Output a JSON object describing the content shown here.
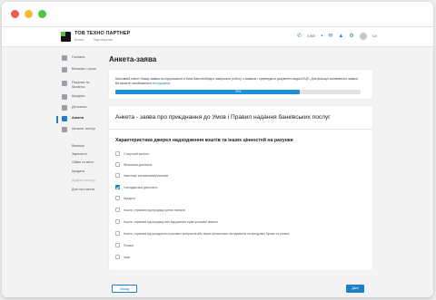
{
  "colors": {
    "accent": "#1e7fc4",
    "progress": "#1e90d6",
    "logo_green": "#5dbb3f"
  },
  "header": {
    "company": "ТОВ ТЕХНО ПАРТНЕР",
    "company_tags": [
      "Бізнес",
      "Партнерство"
    ],
    "phone": "0 800",
    "lang": "UA",
    "icons": [
      "phone-icon",
      "chat-icon",
      "mail-icon",
      "bell-icon",
      "settings-icon"
    ]
  },
  "sidebar": {
    "items": [
      {
        "label": "Головна"
      },
      {
        "label": "Виписки і гроші"
      },
      {
        "label": "Рахунки та баланси"
      },
      {
        "label": "Кредити"
      },
      {
        "label": "Депозити"
      },
      {
        "label": "Анкета"
      },
      {
        "label": "Каталог послуг"
      }
    ],
    "sub_items": [
      "Виписки",
      "Зарплатні",
      "Обмін та звіти",
      "Кредиты",
      "Додати послугу",
      "Для чого метка"
    ]
  },
  "page": {
    "title": "Анкета-заява"
  },
  "notice": {
    "text": "Шановний клієнт! Вище заявки на підтримання в Банк Вам необхідно завершити роботу з заявкою і підтвердити документи видачі ЕЦП. Для фіксації заповненого заявки Ви можете ознайомитися",
    "link": "інструкціями",
    "progress_pct": 75,
    "progress_label": "75%"
  },
  "form": {
    "title": "Анкета - заява про приєднання до Умов і Правил надання банківських послуг",
    "section_title": "Характеристика джерел надходження коштів та інших цінностей на рахунки",
    "options": [
      {
        "label": "Статутний капітал",
        "checked": false
      },
      {
        "label": "Фінансова допомога",
        "checked": false
      },
      {
        "label": "Інвестиції засновників/учасників",
        "checked": false
      },
      {
        "label": "Господарська діяльність",
        "checked": true
      },
      {
        "label": "Кредити",
        "checked": false
      },
      {
        "label": "Кошти, отримані від продажу цінних паперів",
        "checked": false
      },
      {
        "label": "Кошти, отримані від продажу або відчуження прав грошової вимоги",
        "checked": false
      },
      {
        "label": "Кошти, отримані від укладання строкових контрактів або інших фінансових інструментів на фондових біржах та ринках",
        "checked": false
      },
      {
        "label": "Позики",
        "checked": false
      },
      {
        "label": "Інше",
        "checked": false
      }
    ]
  },
  "footer": {
    "back_label": "Назад",
    "next_label": "Далі"
  }
}
